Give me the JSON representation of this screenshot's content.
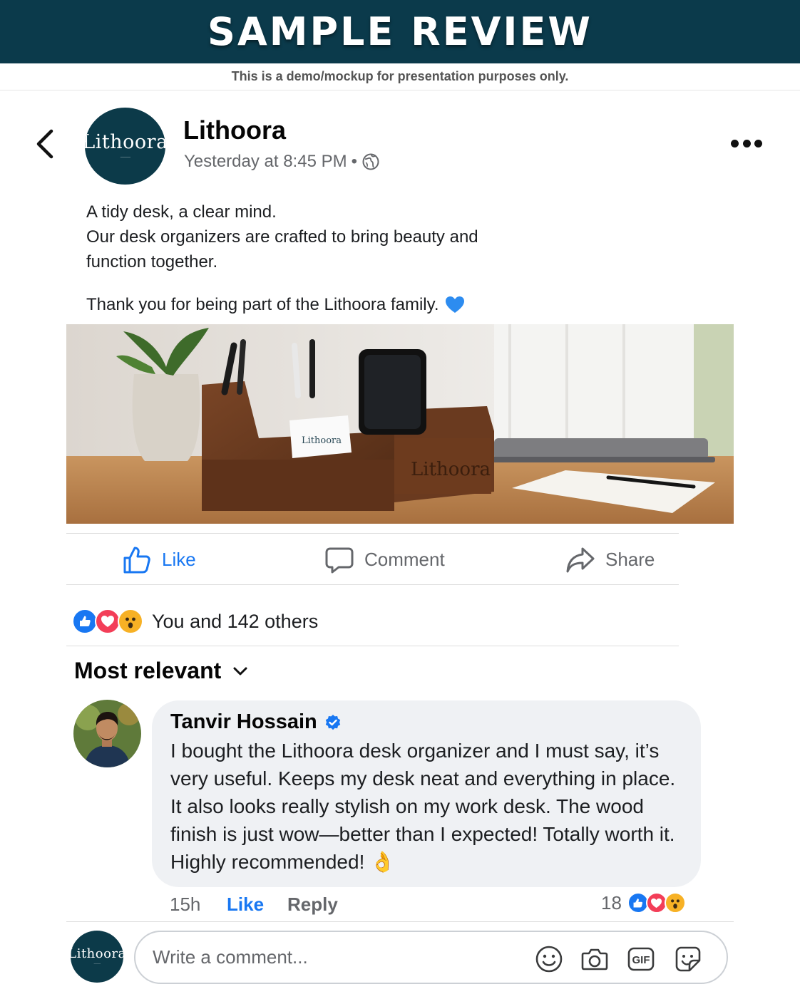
{
  "banner": {
    "title": "SAMPLE REVIEW",
    "subtitle": "This is a demo/mockup for presentation purposes only."
  },
  "post": {
    "page_name": "Lithoora",
    "timestamp": "Yesterday at 8:45 PM",
    "separator": "•",
    "privacy_icon": "globe-icon",
    "avatar_logo": "Lithoora",
    "text_lines": [
      "A tidy desk, a clear mind.",
      "Our desk organizers are crafted to bring beauty and",
      "function together."
    ],
    "closing_line": "Thank you for being part of the Lithoora family.",
    "closing_emoji": "blue-heart-icon",
    "image_brand_text": "Lithoora"
  },
  "actions": {
    "like": "Like",
    "comment": "Comment",
    "share": "Share"
  },
  "reactions": {
    "summary": "You and 142 others",
    "types": [
      "like",
      "love",
      "wow"
    ]
  },
  "comments_sort": {
    "label": "Most relevant"
  },
  "comment": {
    "author": "Tanvir Hossain",
    "verified": true,
    "text": "I bought the Lithoora desk organizer and I must say, it’s very useful. Keeps my desk neat and everything in place. It also looks really stylish on my work desk. The wood finish is just wow—better than I expected! Totally worth it. Highly recommended! 👌",
    "time": "15h",
    "like_label": "Like",
    "reply_label": "Reply",
    "reaction_count": "18"
  },
  "composer": {
    "placeholder": "Write a comment...",
    "avatar_logo": "Lithoora",
    "tools": [
      "emoji-icon",
      "camera-icon",
      "gif-icon",
      "sticker-icon"
    ],
    "gif_label": "GIF"
  },
  "colors": {
    "brand_dark": "#0b3a4b",
    "facebook_blue": "#1877f2",
    "muted_text": "#65676b",
    "bubble_bg": "#eff1f4",
    "love_red": "#f33e58",
    "wow_yellow": "#f7b125"
  }
}
